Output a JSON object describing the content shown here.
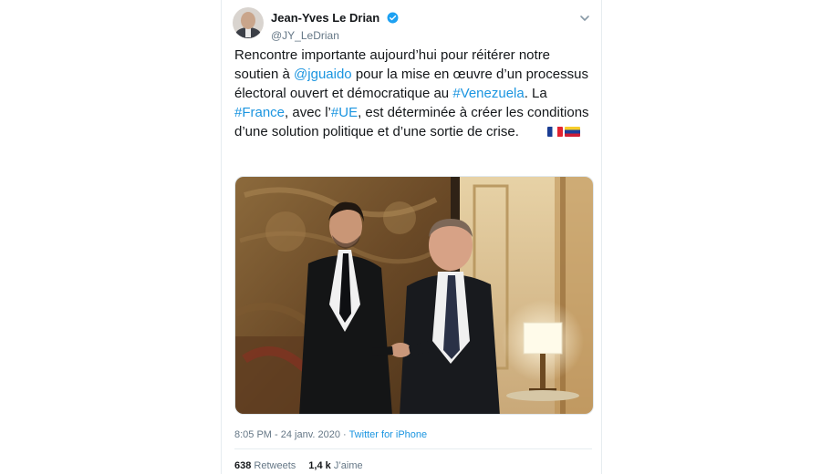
{
  "tweet": {
    "author": {
      "display_name": "Jean-Yves Le Drian",
      "handle": "@JY_LeDrian",
      "verified": true
    },
    "text": {
      "p1": "Rencontre importante aujourd’hui pour réitérer notre soutien à ",
      "mention": "@jguaido",
      "p2": " pour la mise en œuvre d’un processus électoral ouvert et démocratique au ",
      "hashtag_venezuela": "#Venezuela",
      "p3": ". La ",
      "hashtag_france": "#France",
      "p4": ", avec l’",
      "hashtag_ue": "#UE",
      "p5": ", est déterminée à créer les conditions d’une solution politique et d’une sortie de crise."
    },
    "flags": [
      "flag-france",
      "flag-venezuela"
    ],
    "timestamp": "8:05 PM - 24 janv. 2020",
    "separator": " · ",
    "source": "Twitter for iPhone",
    "retweets_count": "638",
    "retweets_label": "Retweets",
    "likes_count": "1,4 k",
    "likes_label": "J’aime"
  },
  "colors": {
    "link": "#1b95e0",
    "text": "#14171a",
    "secondary": "#657786",
    "border": "#e6ecf0"
  }
}
